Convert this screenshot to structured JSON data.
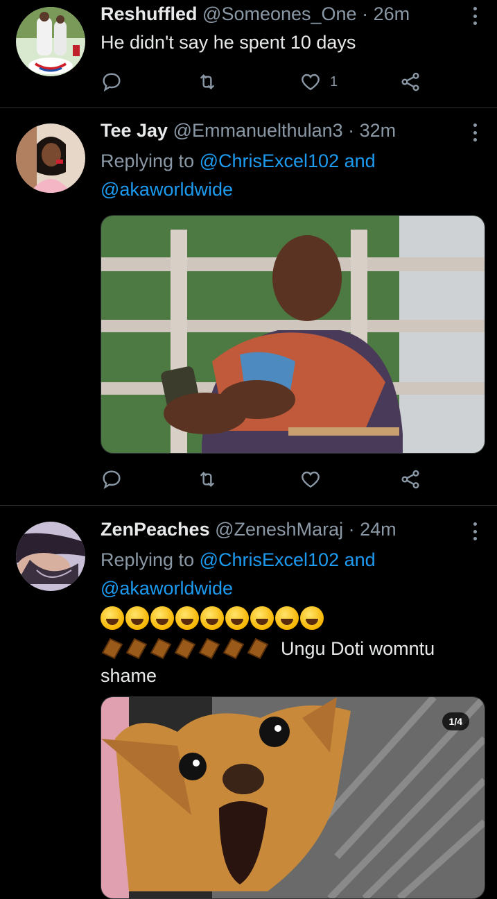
{
  "tweets": [
    {
      "name": "Reshuffled",
      "handle": "@Someones_One",
      "time": "· 26m",
      "text": "He didn't say he spent 10 days",
      "like_count": "1"
    },
    {
      "name": "Tee Jay",
      "handle": "@Emmanuelthulan3",
      "time": "· 32m",
      "replying_prefix": "Replying to ",
      "reply_handle_1": "@ChrisExcel102",
      "reply_and": " and",
      "reply_handle_2": "@akaworldwide"
    },
    {
      "name": "ZenPeaches",
      "handle": "@ZeneshMaraj",
      "time": "· 24m",
      "replying_prefix": "Replying to ",
      "reply_handle_1": "@ChrisExcel102",
      "reply_and": " and",
      "reply_handle_2": "@akaworldwide",
      "text_line": "Ungu Doti womntu",
      "text_line2": "shame",
      "media_counter": "1/4"
    }
  ],
  "icons": [
    "reply-icon",
    "retweet-icon",
    "like-icon",
    "share-icon",
    "more-icon"
  ],
  "colors": {
    "background": "#000000",
    "link": "#1d9bf0",
    "muted": "#8b98a5"
  }
}
